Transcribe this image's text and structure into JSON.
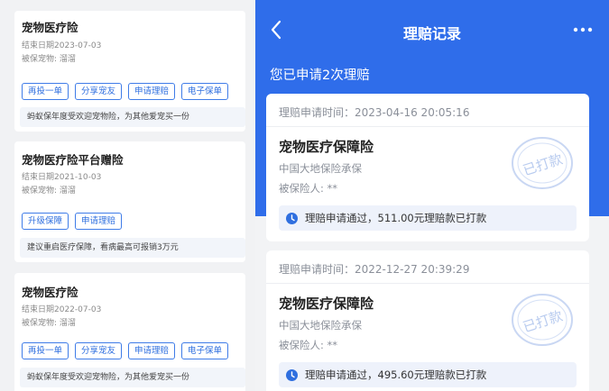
{
  "policies": [
    {
      "title": "宠物医疗险",
      "end_date": "结束日期2023-07-03",
      "insured_pet": "被保宠物: 溜溜",
      "buttons": [
        "再投一单",
        "分享宠友",
        "申请理赔",
        "电子保单"
      ],
      "tip": "蚂蚁保年度受欢迎宠物险，为其他爱宠买一份"
    },
    {
      "title": "宠物医疗险平台赠险",
      "end_date": "结束日期2021-10-03",
      "insured_pet": "被保宠物: 溜溜",
      "buttons": [
        "升级保障",
        "申请理赔"
      ],
      "tip": "建议重启医疗保障，看病最高可报销3万元"
    },
    {
      "title": "宠物医疗险",
      "end_date": "结束日期2022-07-03",
      "insured_pet": "被保宠物: 溜溜",
      "buttons": [
        "再投一单",
        "分享宠友",
        "申请理赔",
        "电子保单"
      ],
      "tip": "蚂蚁保年度受欢迎宠物险，为其他爱宠买一份"
    }
  ],
  "claims_page": {
    "title": "理赔记录",
    "summary": "您已申请2次理赔",
    "back_icon": "chevron-left-icon",
    "more_icon": "more-dots-icon",
    "stamp_text": "已打款",
    "colors": {
      "header": "#2f6dea",
      "accent": "#2f6fdf"
    },
    "claims": [
      {
        "time": "理赔申请时间：2023-04-16 20:05:16",
        "product": "宠物医疗保障险",
        "insurer": "中国大地保险承保",
        "insured": "被保险人: **",
        "status": "理赔申请通过，511.00元理赔款已打款"
      },
      {
        "time": "理赔申请时间：2022-12-27 20:39:29",
        "product": "宠物医疗保障险",
        "insurer": "中国大地保险承保",
        "insured": "被保险人: **",
        "status": "理赔申请通过，495.60元理赔款已打款"
      }
    ]
  }
}
